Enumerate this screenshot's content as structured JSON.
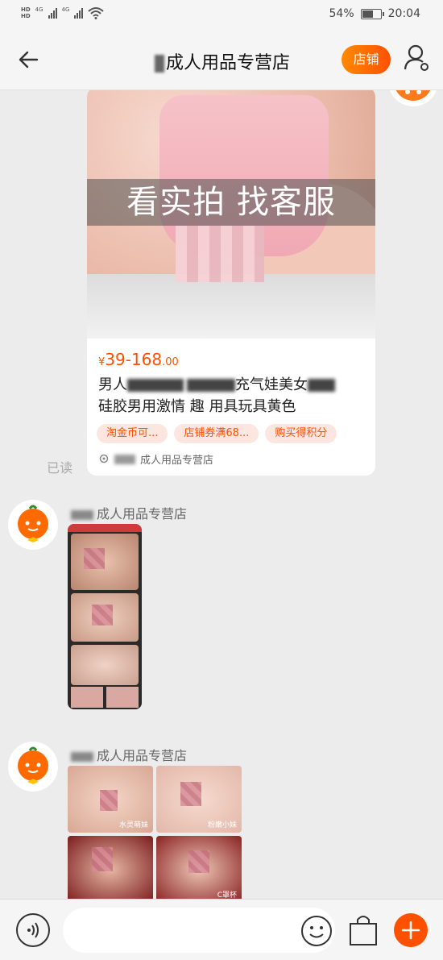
{
  "status_bar": {
    "hd1": "HD",
    "net1": "4G",
    "hd2": "HD",
    "net2": "4G",
    "battery_text": "54%",
    "battery_level": 0.54,
    "time": "20:04"
  },
  "header": {
    "title": "成人用品专营店",
    "shop_button": "店铺"
  },
  "product_card": {
    "banner_text": "看实拍 找客服",
    "price_symbol": "¥",
    "price_range": "39-168",
    "price_decimal": ".00",
    "title_line1_a": "男人",
    "title_line1_b": "充气娃美女",
    "title_line2": "硅胶男用激情 趣 用具玩具黄色",
    "tags": [
      "淘金币可...",
      "店铺券满68...",
      "购买得积分"
    ],
    "shop_name": "成人用品专营店"
  },
  "read_status": "已读",
  "messages": [
    {
      "sender": "成人用品专营店"
    },
    {
      "sender": "成人用品专营店",
      "captions": [
        "水灵萌妹",
        "粉嫩小妹",
        "",
        "C罩杯"
      ]
    }
  ],
  "colors": {
    "accent": "#ff5000",
    "background": "#ececec"
  },
  "icons": {
    "back": "arrow-left-icon",
    "user": "user-settings-icon",
    "voice": "voice-icon",
    "emoji": "smiley-icon",
    "bag": "shopping-bag-icon",
    "plus": "plus-icon"
  }
}
